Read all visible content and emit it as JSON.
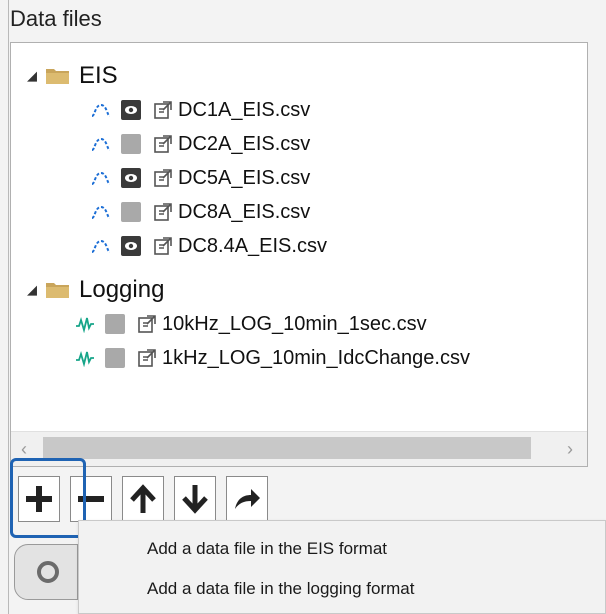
{
  "panel": {
    "title": "Data files"
  },
  "tree": {
    "groups": [
      {
        "label": "EIS",
        "files": [
          {
            "name": "DC1A_EIS.csv",
            "visible": true
          },
          {
            "name": "DC2A_EIS.csv",
            "visible": false
          },
          {
            "name": "DC5A_EIS.csv",
            "visible": true
          },
          {
            "name": "DC8A_EIS.csv",
            "visible": false
          },
          {
            "name": "DC8.4A_EIS.csv",
            "visible": true
          }
        ]
      },
      {
        "label": "Logging",
        "files": [
          {
            "name": "10kHz_LOG_10min_1sec.csv",
            "visible": false
          },
          {
            "name": "1kHz_LOG_10min_IdcChange.csv",
            "visible": false
          }
        ]
      }
    ]
  },
  "toolbar": {
    "buttons": [
      "add-icon",
      "remove-icon",
      "move-up-icon",
      "move-down-icon",
      "export-icon"
    ]
  },
  "context_menu": {
    "items": [
      "Add a data file in the EIS format",
      "Add a data file in the logging format"
    ]
  },
  "colors": {
    "eis_wave": "#1d6fd6",
    "logging_wave": "#17a589",
    "folder": "#c9a55b",
    "highlight": "#1f63b3"
  }
}
